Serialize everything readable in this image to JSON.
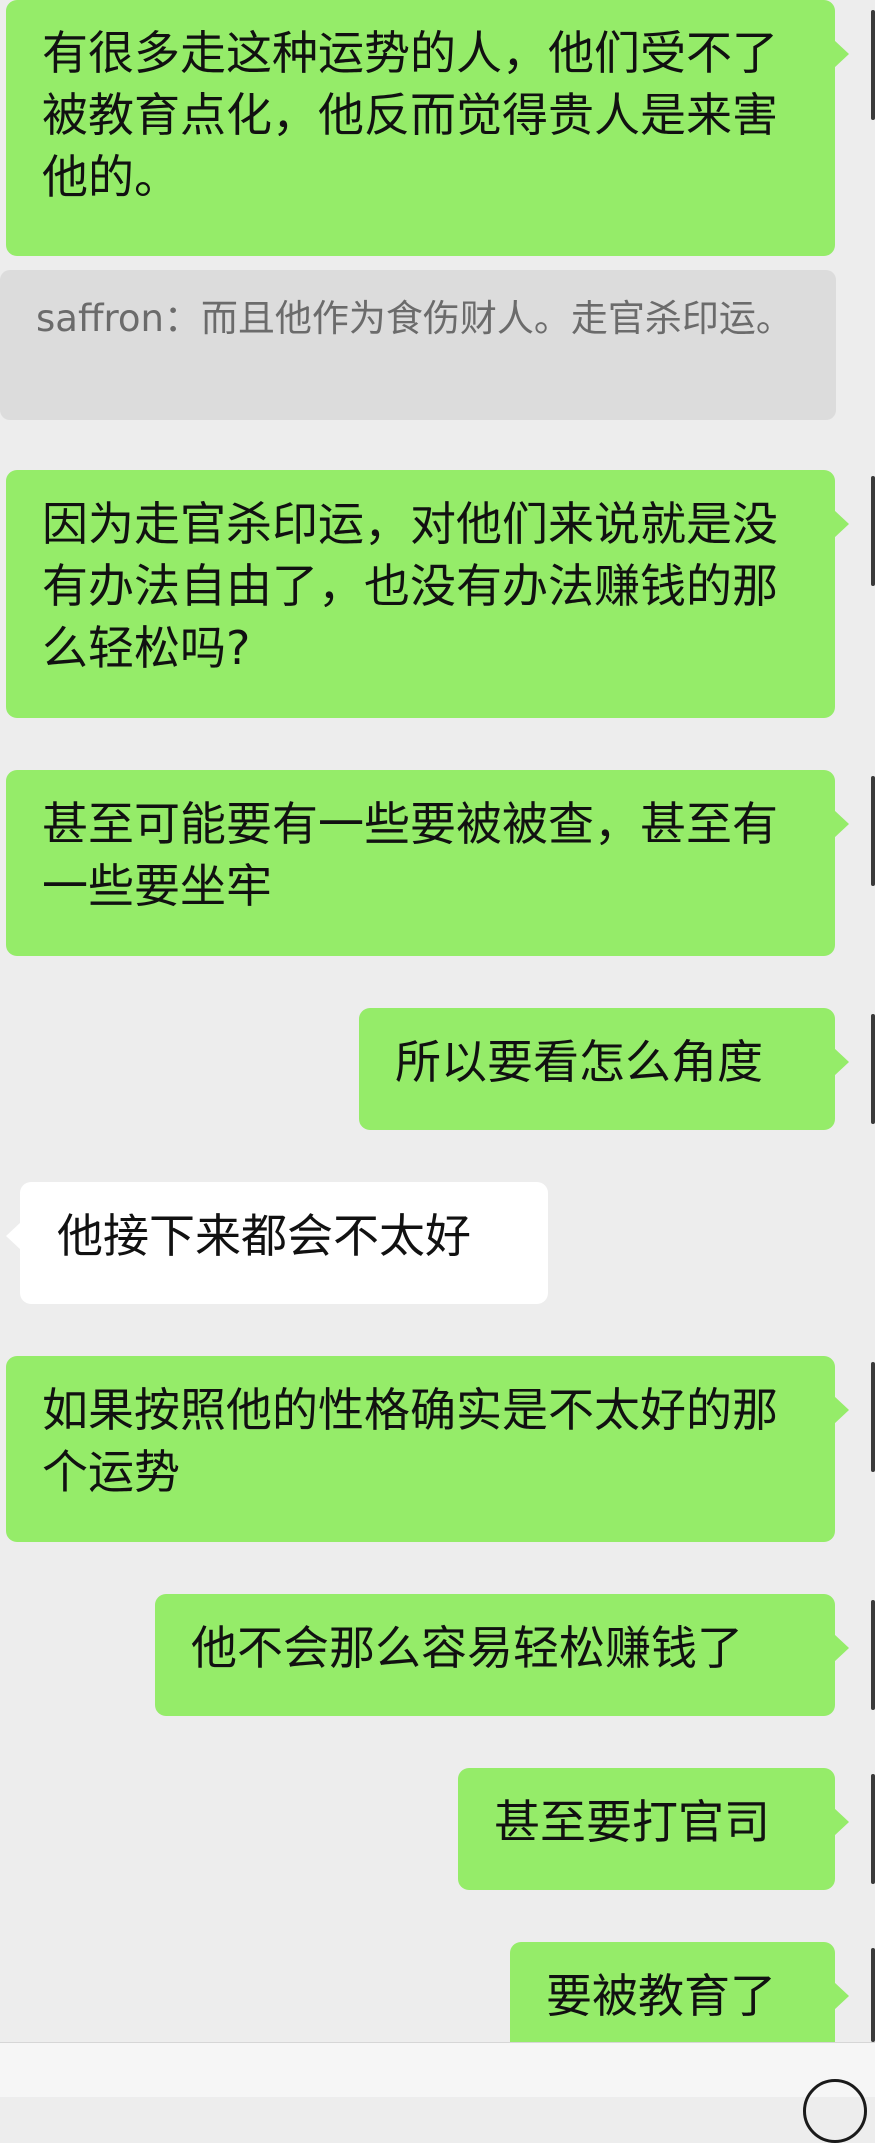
{
  "conversation": {
    "messages": [
      {
        "side": "right",
        "text": "有很多走这种运势的人，他们受不了被教育点化，他反而觉得贵人是来害他的。"
      },
      {
        "type": "quote",
        "text": "saffron：而且他作为食伤财人。走官杀印运。"
      },
      {
        "side": "right",
        "text": "因为走官杀印运，对他们来说就是没有办法自由了，也没有办法赚钱的那么轻松吗?"
      },
      {
        "side": "right",
        "text": "甚至可能要有一些要被被查，甚至有一些要坐牢"
      },
      {
        "side": "right",
        "text": "所以要看怎么角度"
      },
      {
        "side": "left",
        "text": "他接下来都会不太好"
      },
      {
        "side": "right",
        "text": "如果按照他的性格确实是不太好的那个运势"
      },
      {
        "side": "right",
        "text": "他不会那么容易轻松赚钱了"
      },
      {
        "side": "right",
        "text": "甚至要打官司"
      },
      {
        "side": "right",
        "text": "要被教育了"
      }
    ]
  },
  "colors": {
    "background": "#ededed",
    "self_bubble": "#95ec69",
    "other_bubble": "#ffffff",
    "quote_bubble": "#dcdcdc"
  }
}
